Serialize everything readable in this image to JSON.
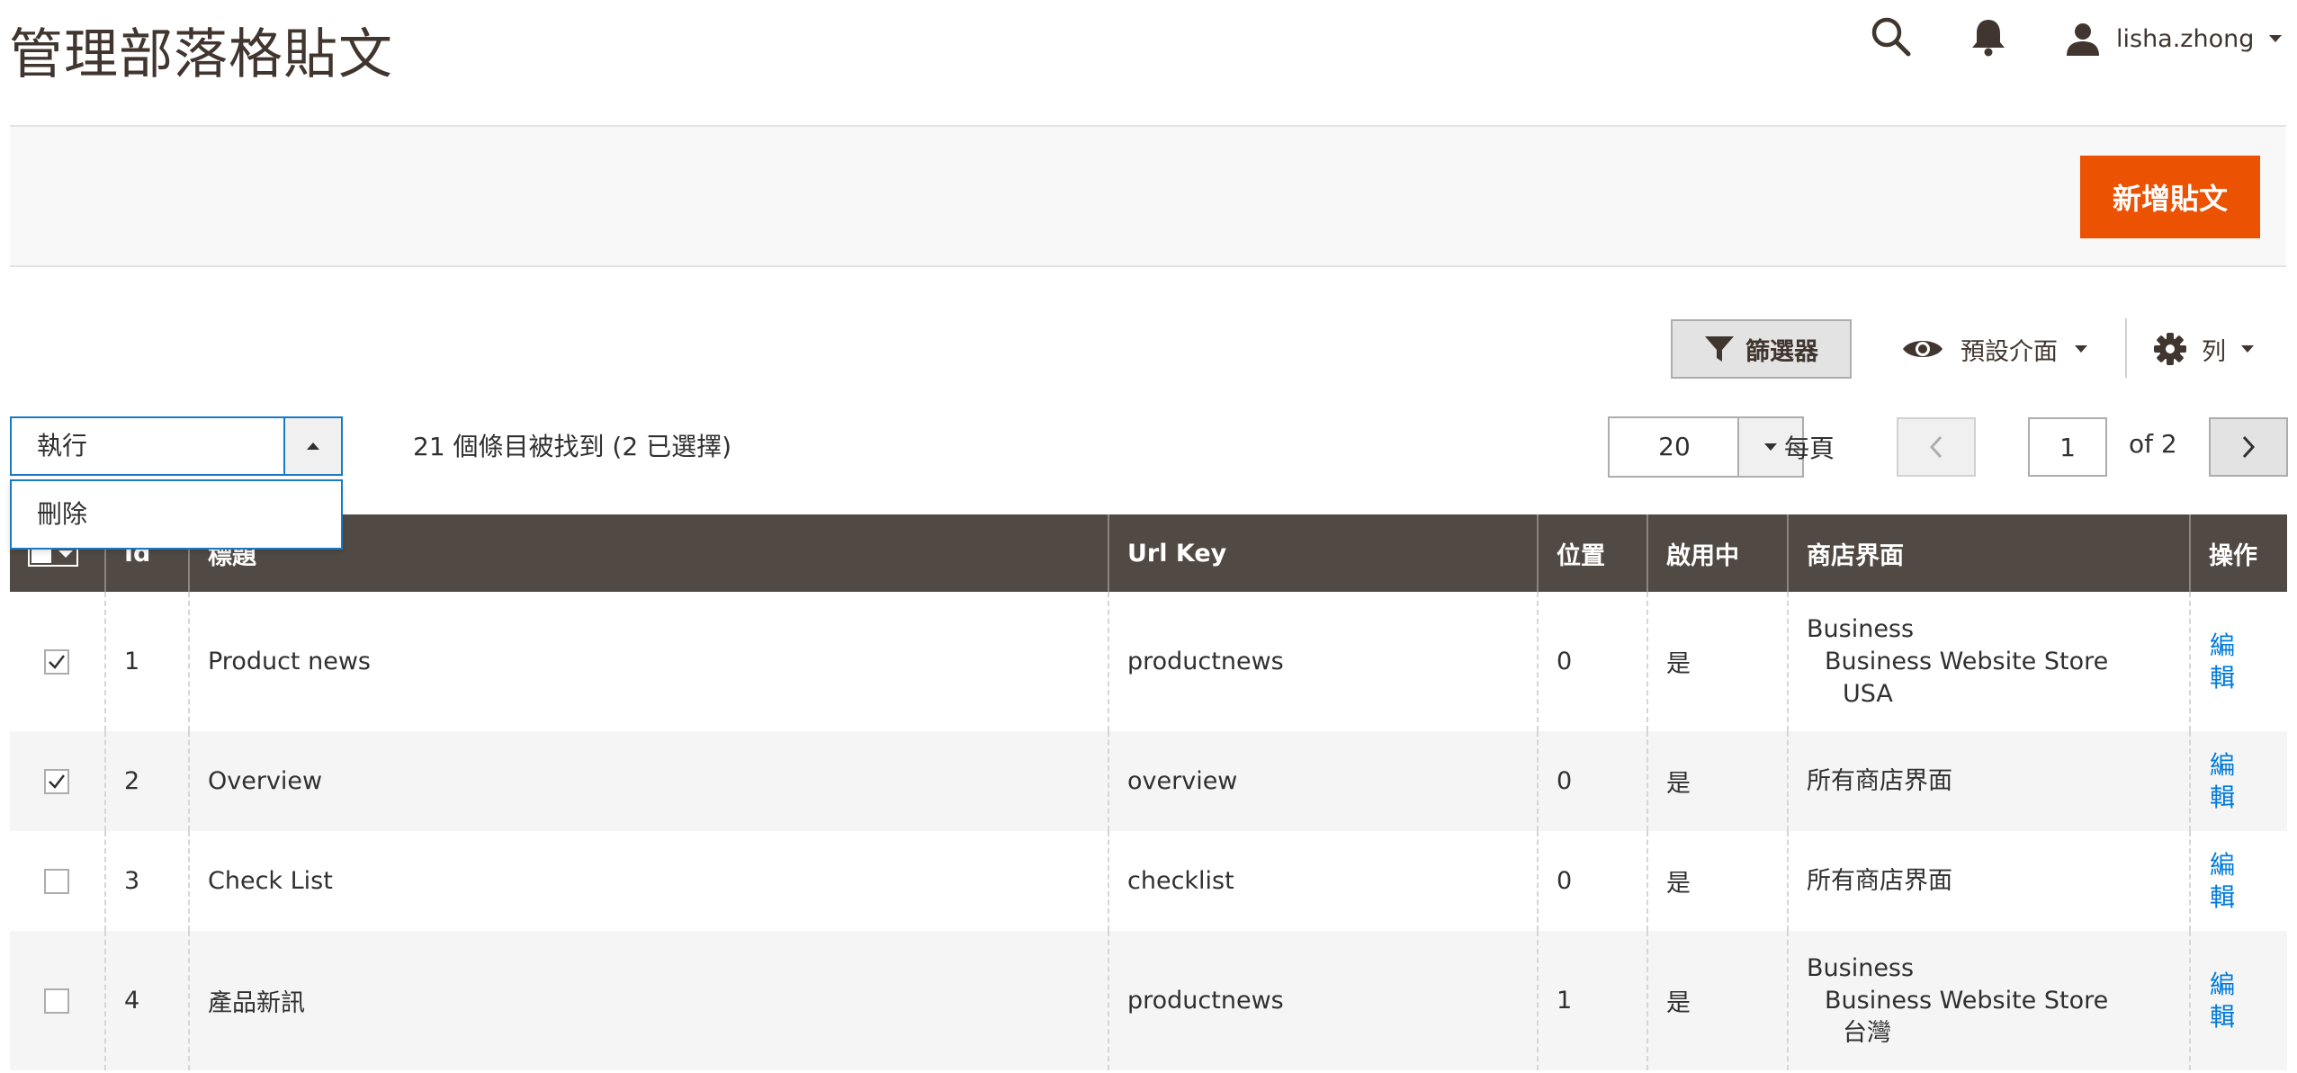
{
  "header": {
    "title": "管理部落格貼文",
    "user": "lisha.zhong"
  },
  "page_actions": {
    "add_post": "新增貼文"
  },
  "toolbar": {
    "filters": "篩選器",
    "view": "預設介面",
    "columns": "列"
  },
  "mass_actions": {
    "label": "執行",
    "options": [
      "刪除"
    ]
  },
  "records_found": "21 個條目被找到 (2 已選擇)",
  "pager": {
    "per_page": "20",
    "per_page_label": "每頁",
    "current_page": "1",
    "total_pages": "of 2"
  },
  "grid": {
    "columns": [
      "Id",
      "標題",
      "Url Key",
      "位置",
      "啟用中",
      "商店界面",
      "操作"
    ],
    "rows": [
      {
        "checked": true,
        "id": "1",
        "title": "Product news",
        "url_key": "productnews",
        "position": "0",
        "enabled": "是",
        "store_lines": [
          "Business",
          "Business Website Store",
          "USA"
        ],
        "action_lines": [
          "編",
          "輯"
        ]
      },
      {
        "checked": true,
        "id": "2",
        "title": "Overview",
        "url_key": "overview",
        "position": "0",
        "enabled": "是",
        "store_lines": [
          "所有商店界面"
        ],
        "action_lines": [
          "編",
          "輯"
        ]
      },
      {
        "checked": false,
        "id": "3",
        "title": "Check List",
        "url_key": "checklist",
        "position": "0",
        "enabled": "是",
        "store_lines": [
          "所有商店界面"
        ],
        "action_lines": [
          "編",
          "輯"
        ]
      },
      {
        "checked": false,
        "id": "4",
        "title": "產品新訊",
        "url_key": "productnews",
        "position": "1",
        "enabled": "是",
        "store_lines": [
          "Business",
          "Business Website Store",
          "台灣"
        ],
        "action_lines": [
          "編",
          "輯"
        ]
      }
    ]
  },
  "colors": {
    "accent": "#eb5202",
    "header_bg": "#514943",
    "link": "#007bdb",
    "active_border": "#1979c3"
  }
}
